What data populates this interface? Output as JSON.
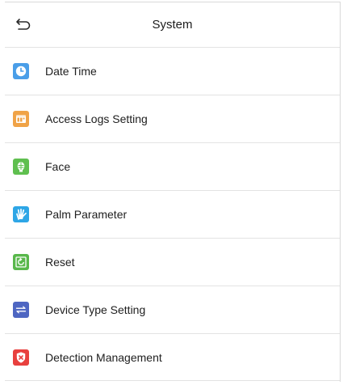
{
  "header": {
    "title": "System",
    "back_icon": "back-arrow-icon"
  },
  "menu": {
    "items": [
      {
        "label": "Date Time",
        "icon": "clock-icon",
        "color": "#4a9ee8"
      },
      {
        "label": "Access Logs Setting",
        "icon": "log-record-icon",
        "color": "#f0a347"
      },
      {
        "label": "Face",
        "icon": "face-icon",
        "color": "#5fbf4f"
      },
      {
        "label": "Palm Parameter",
        "icon": "palm-icon",
        "color": "#2ea6e6"
      },
      {
        "label": "Reset",
        "icon": "reset-icon",
        "color": "#59b84b"
      },
      {
        "label": "Device Type Setting",
        "icon": "device-type-icon",
        "color": "#4e66c2"
      },
      {
        "label": "Detection Management",
        "icon": "shield-icon",
        "color": "#e8403e"
      }
    ]
  }
}
